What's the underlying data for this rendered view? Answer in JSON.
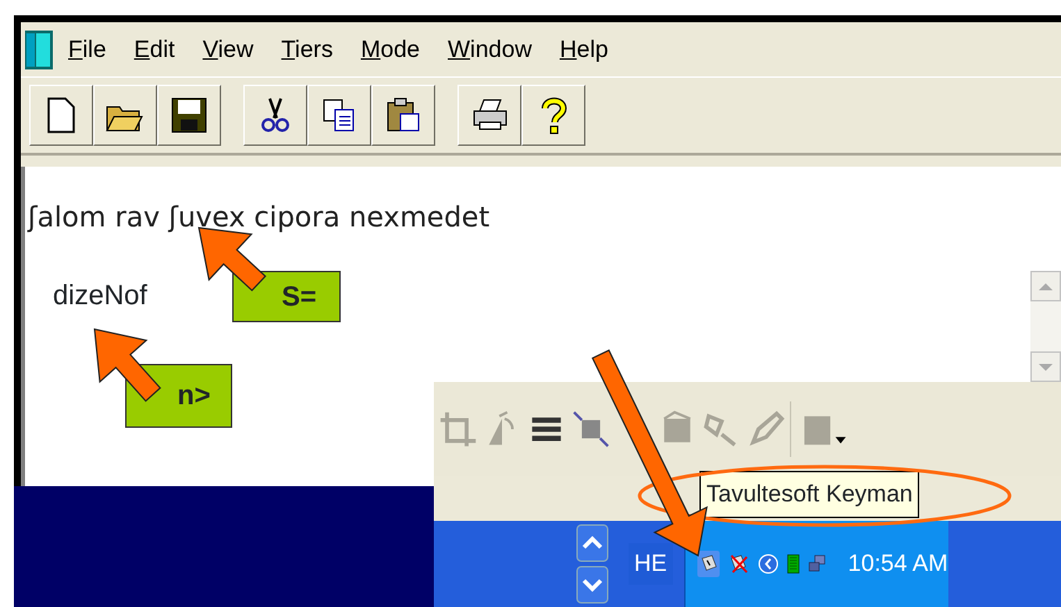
{
  "menu": [
    "File",
    "Edit",
    "View",
    "Tiers",
    "Mode",
    "Window",
    "Help"
  ],
  "editor": {
    "lines": [
      "ʃalom rav ʃuvex cipora nexmedet"
    ],
    "sample": "dizeNof"
  },
  "callouts": [
    {
      "text": "S="
    },
    {
      "text": "n>"
    }
  ],
  "tooltip": "Tavultesoft Keyman",
  "taskbar": {
    "language": "HE",
    "clock": "10:54 AM"
  }
}
